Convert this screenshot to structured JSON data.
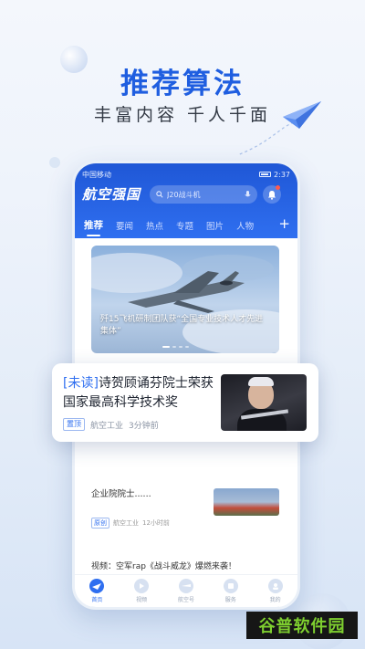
{
  "hero": {
    "title": "推荐算法",
    "subtitle": "丰富内容 千人千面"
  },
  "phone": {
    "status_bar": {
      "carrier": "中国移动",
      "time": "2:37"
    },
    "app": {
      "logo_text": "航空强国",
      "search_placeholder": "J20战斗机",
      "tabs": [
        {
          "label": "推荐",
          "active": true
        },
        {
          "label": "要闻",
          "active": false
        },
        {
          "label": "热点",
          "active": false
        },
        {
          "label": "专题",
          "active": false
        },
        {
          "label": "图片",
          "active": false
        },
        {
          "label": "人物",
          "active": false
        }
      ],
      "tab_more": "+"
    },
    "feed": {
      "banner": {
        "caption": "歼15飞机研制团队获“全国专业技术人才先进集体”"
      },
      "row2": {
        "title": "企业院院士......",
        "tag": "原创",
        "source": "航空工业",
        "time": "12小时前"
      },
      "video": {
        "title": "视频：空军rap《战斗威龙》爆燃来袭！"
      }
    },
    "bottom_nav": [
      {
        "label": "首页",
        "active": true
      },
      {
        "label": "视频",
        "active": false
      },
      {
        "label": "航空号",
        "active": false
      },
      {
        "label": "服务",
        "active": false
      },
      {
        "label": "我的",
        "active": false
      }
    ]
  },
  "popup_card": {
    "unread_tag": "[未读]",
    "title": "诗贺顾诵芬院士荣获国家最高科学技术奖",
    "tag": "置顶",
    "source": "航空工业",
    "time": "3分钟前"
  },
  "watermark": "谷普软件园",
  "colors": {
    "accent": "#2f6ff0",
    "hero_title": "#1f5ee0",
    "header_bg": "#1f57d6",
    "watermark_text": "#7ecf2f"
  }
}
